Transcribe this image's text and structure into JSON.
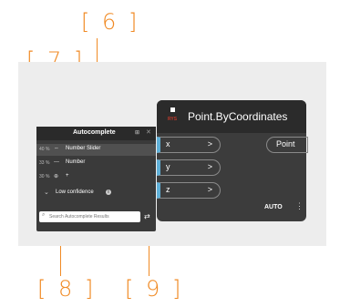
{
  "callouts": [
    "[ 6 ]",
    "[ 7 ]",
    "[ 8 ]",
    "[ 9 ]"
  ],
  "node": {
    "icon_tag": "RYS",
    "title": "Point.ByCoordinates",
    "inputs": [
      {
        "name": "x",
        "arrow": ">"
      },
      {
        "name": "y",
        "arrow": ">"
      },
      {
        "name": "z",
        "arrow": ">"
      }
    ],
    "output": "Point",
    "lacing": "AUTO",
    "menu_glyph": "⋮"
  },
  "autocomplete": {
    "title": "Autocomplete",
    "pin_glyph": "⊞",
    "close_glyph": "✕",
    "results": [
      {
        "percent": "40 %",
        "icon": "⇔",
        "label": "Number Slider"
      },
      {
        "percent": "33 %",
        "icon": "—",
        "label": "Number"
      },
      {
        "percent": "30 %",
        "icon": "⊕",
        "label": "+"
      }
    ],
    "low_confidence": {
      "label": "Low confidence",
      "chevron": "⌄",
      "info": "i"
    },
    "search_placeholder": "Search Autocomplete Results",
    "search_glyph": "⌕",
    "filter_glyph": "⇄"
  },
  "colors": {
    "callout": "#f08a24",
    "port_accent": "#5fb0d8",
    "node_bg": "#3c3c3c",
    "panel_bg": "#3a3a3a"
  }
}
